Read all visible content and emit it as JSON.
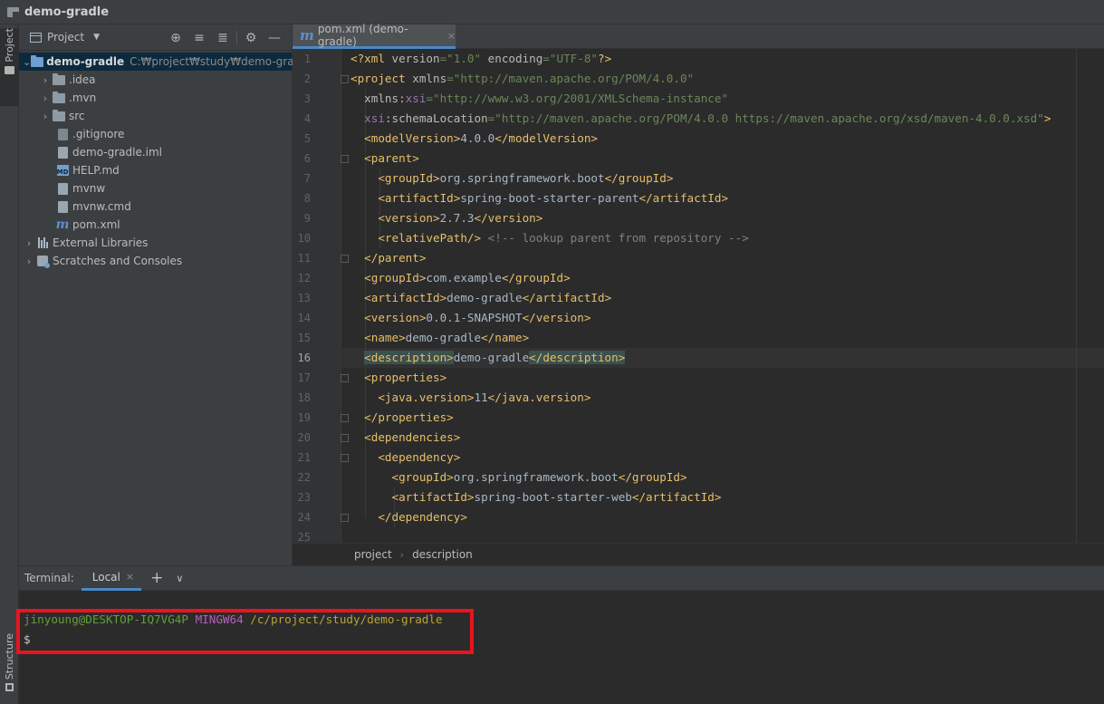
{
  "window": {
    "title": "demo-gradle"
  },
  "left_strip": {
    "project_tab": "Project",
    "structure_tab": "Structure"
  },
  "project_panel": {
    "header_title": "Project",
    "tools": [
      "crosshair-icon",
      "expand-all-icon",
      "collapse-all-icon",
      "gear-icon",
      "minimize-icon"
    ],
    "tree": [
      {
        "label": "demo-gradle",
        "path": "C:₩project₩study₩demo-gradle",
        "kind": "module-folder",
        "expanded": true
      },
      {
        "label": ".idea",
        "kind": "folder"
      },
      {
        "label": ".mvn",
        "kind": "folder"
      },
      {
        "label": "src",
        "kind": "folder"
      },
      {
        "label": ".gitignore",
        "kind": "file"
      },
      {
        "label": "demo-gradle.iml",
        "kind": "file"
      },
      {
        "label": "HELP.md",
        "kind": "markdown"
      },
      {
        "label": "mvnw",
        "kind": "file"
      },
      {
        "label": "mvnw.cmd",
        "kind": "file"
      },
      {
        "label": "pom.xml",
        "kind": "maven"
      },
      {
        "label": "External Libraries",
        "kind": "libraries"
      },
      {
        "label": "Scratches and Consoles",
        "kind": "scratches"
      }
    ]
  },
  "editor": {
    "tab": {
      "label": "pom.xml (demo-gradle)",
      "close": "×"
    },
    "current_line": 16,
    "line_numbers": [
      "1",
      "2",
      "3",
      "4",
      "5",
      "6",
      "7",
      "8",
      "9",
      "10",
      "11",
      "12",
      "13",
      "14",
      "15",
      "16",
      "17",
      "18",
      "19",
      "20",
      "21",
      "22",
      "23",
      "24",
      "25"
    ],
    "breadcrumb": [
      "project",
      "description"
    ]
  },
  "terminal": {
    "title": "Terminal:",
    "tab_label": "Local",
    "tab_close": "×",
    "add": "+",
    "more": "∨",
    "user_host": "jinyoung@DESKTOP-IQ7VG4P",
    "env": "MINGW64",
    "path": "/c/project/study/demo-gradle",
    "prompt": "$"
  },
  "colors": {
    "highlight_box": "#e8141f",
    "accent": "#4a88c7"
  }
}
